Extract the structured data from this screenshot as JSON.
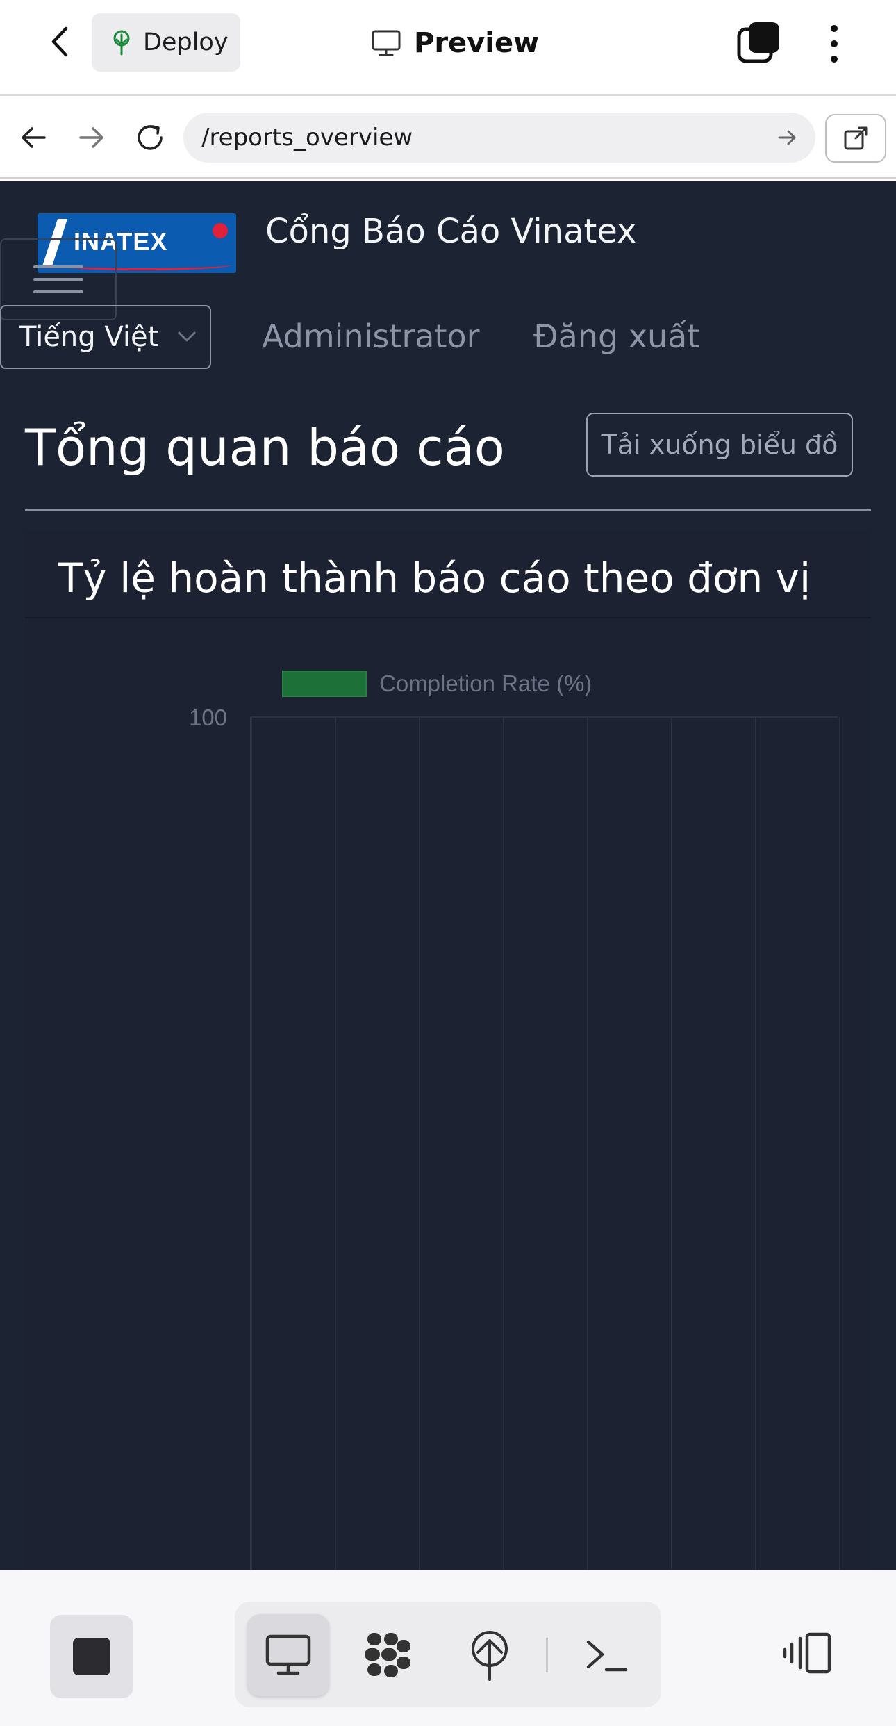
{
  "app_bar": {
    "deploy_label": "Deploy",
    "preview_label": "Preview"
  },
  "browser": {
    "url": "/reports_overview"
  },
  "site": {
    "logo_text": "INATEX",
    "title": "Cổng Báo Cáo Vinatex",
    "language": "Tiếng Việt",
    "nav": {
      "admin": "Administrator",
      "logout": "Đăng xuất"
    }
  },
  "page": {
    "heading": "Tổng quan báo cáo",
    "download_button": "Tải xuống biểu đồ",
    "card_title": "Tỷ lệ hoàn thành báo cáo theo đơn vị"
  },
  "chart_data": {
    "type": "bar",
    "series": [
      {
        "name": "Completion Rate (%)",
        "color": "#1f8a3c",
        "values": []
      }
    ],
    "categories": [],
    "y_tick_labels": [
      "100"
    ],
    "ylim": [
      0,
      100
    ],
    "grid": true,
    "legend": "top"
  },
  "colors": {
    "web_bg": "#1c2333",
    "accent_green": "#1f8a3c"
  },
  "icons": {
    "back": "chevron-left-icon",
    "deploy": "deploy-tree-icon",
    "preview": "monitor-icon",
    "tabs": "tabs-icon",
    "more": "more-vertical-icon",
    "nav_back": "arrow-left-icon",
    "nav_forward": "arrow-right-icon",
    "reload": "reload-icon",
    "url_go": "arrow-right-small-icon",
    "external": "external-link-icon",
    "stop": "stop-icon",
    "desktop": "desktop-icon",
    "agent": "agent-icon",
    "deploy_mode": "deploy-mode-icon",
    "terminal": "terminal-icon",
    "panel": "panel-toggle-icon"
  }
}
